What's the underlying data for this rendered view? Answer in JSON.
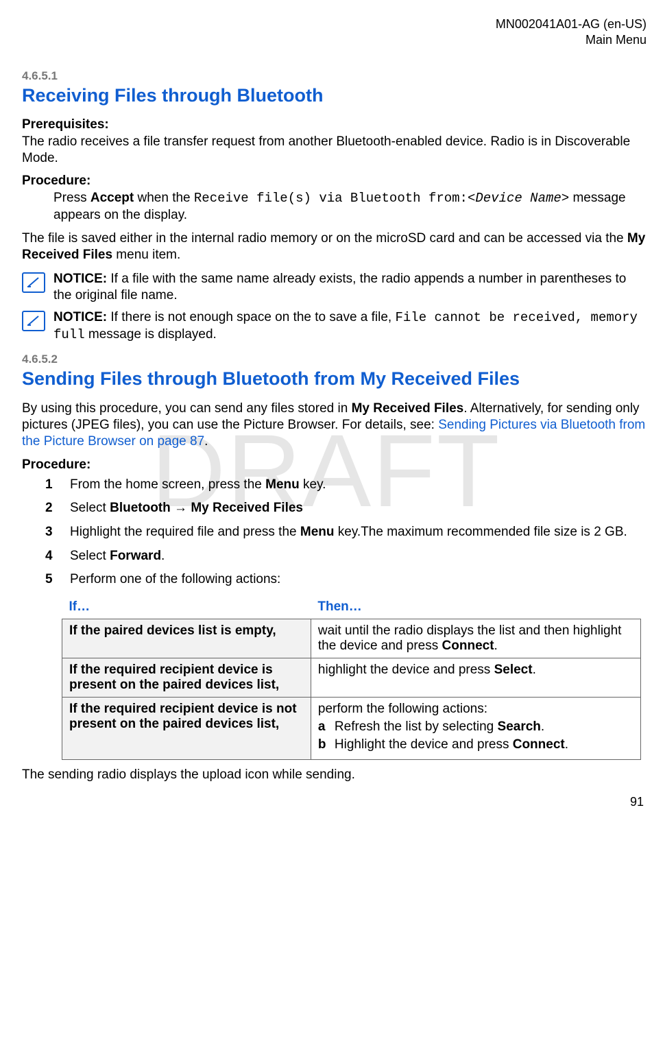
{
  "header": {
    "doc_id": "MN002041A01-AG (en-US)",
    "breadcrumb": "Main Menu"
  },
  "watermark": "DRAFT",
  "section1": {
    "num": "4.6.5.1",
    "title": "Receiving Files through Bluetooth",
    "prereq_label": "Prerequisites:",
    "prereq_text": "The radio receives a file transfer request from another Bluetooth-enabled device. Radio is in Discoverable Mode.",
    "proc_label": "Procedure:",
    "proc_pre": "Press ",
    "proc_accept": "Accept",
    "proc_mid": " when the ",
    "proc_code": "Receive file(s) via Bluetooth from:",
    "proc_dev": "<Device Name>",
    "proc_post": " message appears on the display.",
    "after_pre": "The file is saved either in the internal radio memory or on the microSD card and can be accessed via the ",
    "after_bold": "My Received Files",
    "after_post": " menu item.",
    "notice1_label": "NOTICE:",
    "notice1_text": " If a file with the same name already exists, the radio appends a number in parentheses to the original file name.",
    "notice2_label": "NOTICE:",
    "notice2_pre": " If there is not enough space on the to save a file, ",
    "notice2_code": "File cannot be received, memory full",
    "notice2_post": " message is displayed."
  },
  "section2": {
    "num": "4.6.5.2",
    "title": "Sending Files through Bluetooth from My Received Files",
    "intro_pre": "By using this procedure, you can send any files stored in ",
    "intro_bold": "My Received Files",
    "intro_mid": ". Alternatively, for sending only pictures (JPEG files), you can use the Picture Browser. For details, see: ",
    "intro_link": "Sending Pictures via Bluetooth from the Picture Browser on page 87",
    "intro_post": ".",
    "proc_label": "Procedure:",
    "steps": {
      "s1_pre": "From the home screen, press the ",
      "s1_bold": "Menu",
      "s1_post": " key.",
      "s2_pre": "Select ",
      "s2_b1": "Bluetooth",
      "s2_arrow": " → ",
      "s2_b2": "My Received Files",
      "s3_pre": "Highlight the required file and press the ",
      "s3_bold": "Menu",
      "s3_post": " key.The maximum recommended file size is 2 GB.",
      "s4_pre": "Select ",
      "s4_bold": "Forward",
      "s4_post": ".",
      "s5": "Perform one of the following actions:"
    },
    "table": {
      "h1": "If…",
      "h2": "Then…",
      "r1c1": "If the paired devices list is empty,",
      "r1c2_pre": "wait until the radio displays the list and then highlight the device and press ",
      "r1c2_bold": "Connect",
      "r1c2_post": ".",
      "r2c1": "If the required recipient device is present on the paired devices list,",
      "r2c2_pre": "highlight the device and press ",
      "r2c2_bold": "Select",
      "r2c2_post": ".",
      "r3c1": "If the required recipient device is not present on the paired devices list,",
      "r3c2_intro": "perform the following actions:",
      "r3c2_a_pre": "Refresh the list by selecting ",
      "r3c2_a_bold": "Search",
      "r3c2_a_post": ".",
      "r3c2_b_pre": "Highlight the device and press ",
      "r3c2_b_bold": "Connect",
      "r3c2_b_post": "."
    },
    "closing": "The sending radio displays the upload icon while sending."
  },
  "page_number": "91",
  "chart_data": {
    "type": "table",
    "title": "If/Then actions for sending files via Bluetooth",
    "columns": [
      "If…",
      "Then…"
    ],
    "rows": [
      [
        "If the paired devices list is empty,",
        "wait until the radio displays the list and then highlight the device and press Connect."
      ],
      [
        "If the required recipient device is present on the paired devices list,",
        "highlight the device and press Select."
      ],
      [
        "If the required recipient device is not present on the paired devices list,",
        "perform the following actions: a Refresh the list by selecting Search. b Highlight the device and press Connect."
      ]
    ]
  }
}
